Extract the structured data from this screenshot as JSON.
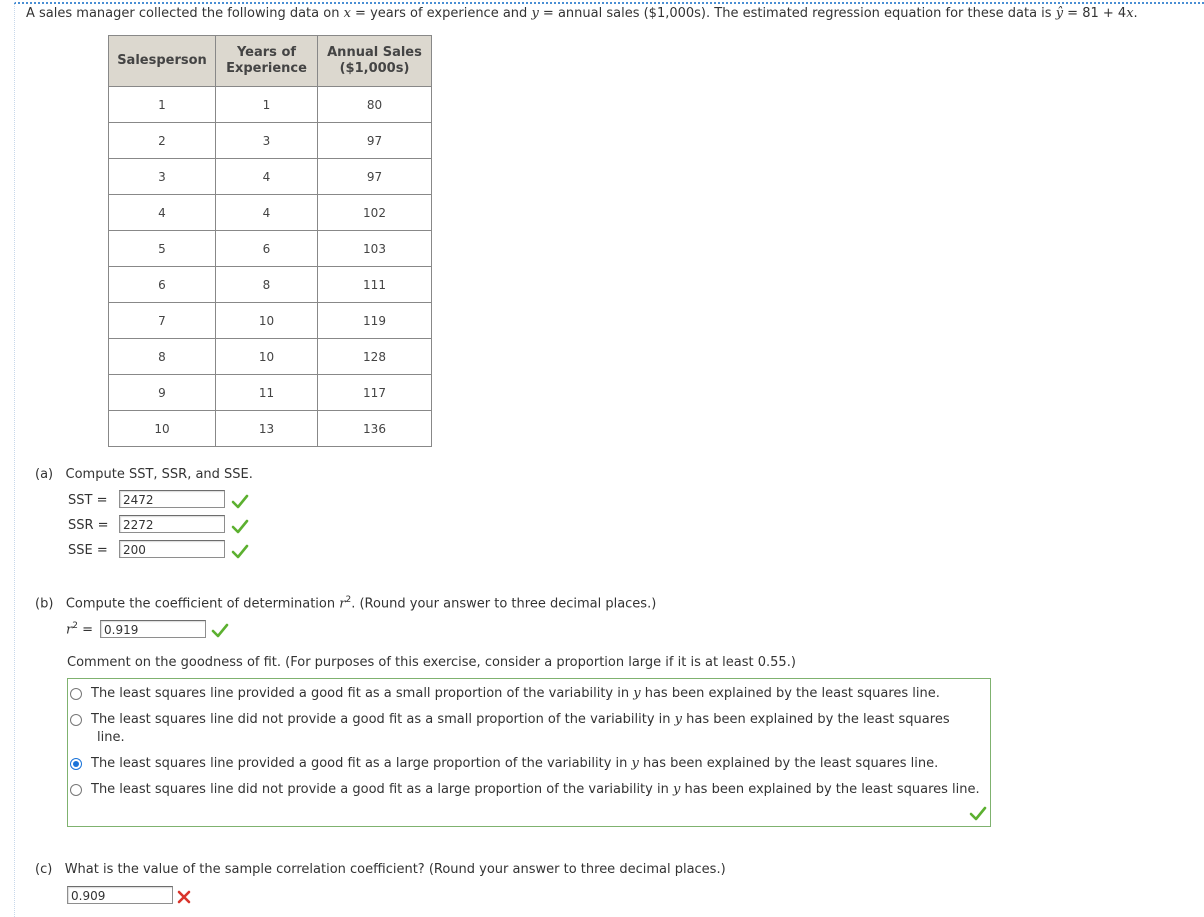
{
  "intro": {
    "prefix": "A sales manager collected the following data on ",
    "x_var": "x",
    "mid1": " = years of experience and ",
    "y_var": "y",
    "mid2": " = annual sales ($1,000s). The estimated regression equation for these data is ",
    "yhat": "ŷ",
    "suffix": " = 81 + 4",
    "x_var2": "x",
    "end": "."
  },
  "table": {
    "headers": [
      "Salesperson",
      "Years of Experience",
      "Annual Sales ($1,000s)"
    ],
    "header_lines": [
      [
        "Salesperson"
      ],
      [
        "Years of",
        "Experience"
      ],
      [
        "Annual Sales",
        "($1,000s)"
      ]
    ],
    "rows": [
      [
        "1",
        "1",
        "80"
      ],
      [
        "2",
        "3",
        "97"
      ],
      [
        "3",
        "4",
        "97"
      ],
      [
        "4",
        "4",
        "102"
      ],
      [
        "5",
        "6",
        "103"
      ],
      [
        "6",
        "8",
        "111"
      ],
      [
        "7",
        "10",
        "119"
      ],
      [
        "8",
        "10",
        "128"
      ],
      [
        "9",
        "11",
        "117"
      ],
      [
        "10",
        "13",
        "136"
      ]
    ]
  },
  "part_a": {
    "label": "(a)",
    "prompt": "Compute SST, SSR, and SSE.",
    "sst_label": "SST =",
    "sst_value": "2472",
    "ssr_label": "SSR =",
    "ssr_value": "2272",
    "sse_label": "SSE =",
    "sse_value": "200"
  },
  "part_b": {
    "label": "(b)",
    "prompt_pre": "Compute the coefficient of determination ",
    "prompt_var": "r",
    "prompt_sup": "2",
    "prompt_post": ". (Round your answer to three decimal places.)",
    "r2_var": "r",
    "r2_sup": "2",
    "r2_eq": "=",
    "r2_value": "0.919",
    "comment": "Comment on the goodness of fit. (For purposes of this exercise, consider a proportion large if it is at least 0.55.)",
    "options": [
      {
        "pre": "The least squares line provided a good fit as a small proportion of the variability in ",
        "var": "y",
        "post": " has been explained by the least squares line.",
        "cont": "",
        "selected": false
      },
      {
        "pre": "The least squares line did not provide a good fit as a small proportion of the variability in ",
        "var": "y",
        "post": " has been explained by the least squares",
        "cont": "line.",
        "selected": false
      },
      {
        "pre": "The least squares line provided a good fit as a large proportion of the variability in ",
        "var": "y",
        "post": " has been explained by the least squares line.",
        "cont": "",
        "selected": true
      },
      {
        "pre": "The least squares line did not provide a good fit as a large proportion of the variability in ",
        "var": "y",
        "post": " has been explained by the least squares line.",
        "cont": "",
        "selected": false
      }
    ]
  },
  "part_c": {
    "label": "(c)",
    "prompt": "What is the value of the sample correlation coefficient? (Round your answer to three decimal places.)",
    "value": "0.909"
  },
  "colors": {
    "correct": "#5cb030",
    "incorrect": "#d9342b",
    "radio_selected": "#1a73d9",
    "frame_border": "#7fb26f",
    "header_bg": "#dcd8cf"
  }
}
